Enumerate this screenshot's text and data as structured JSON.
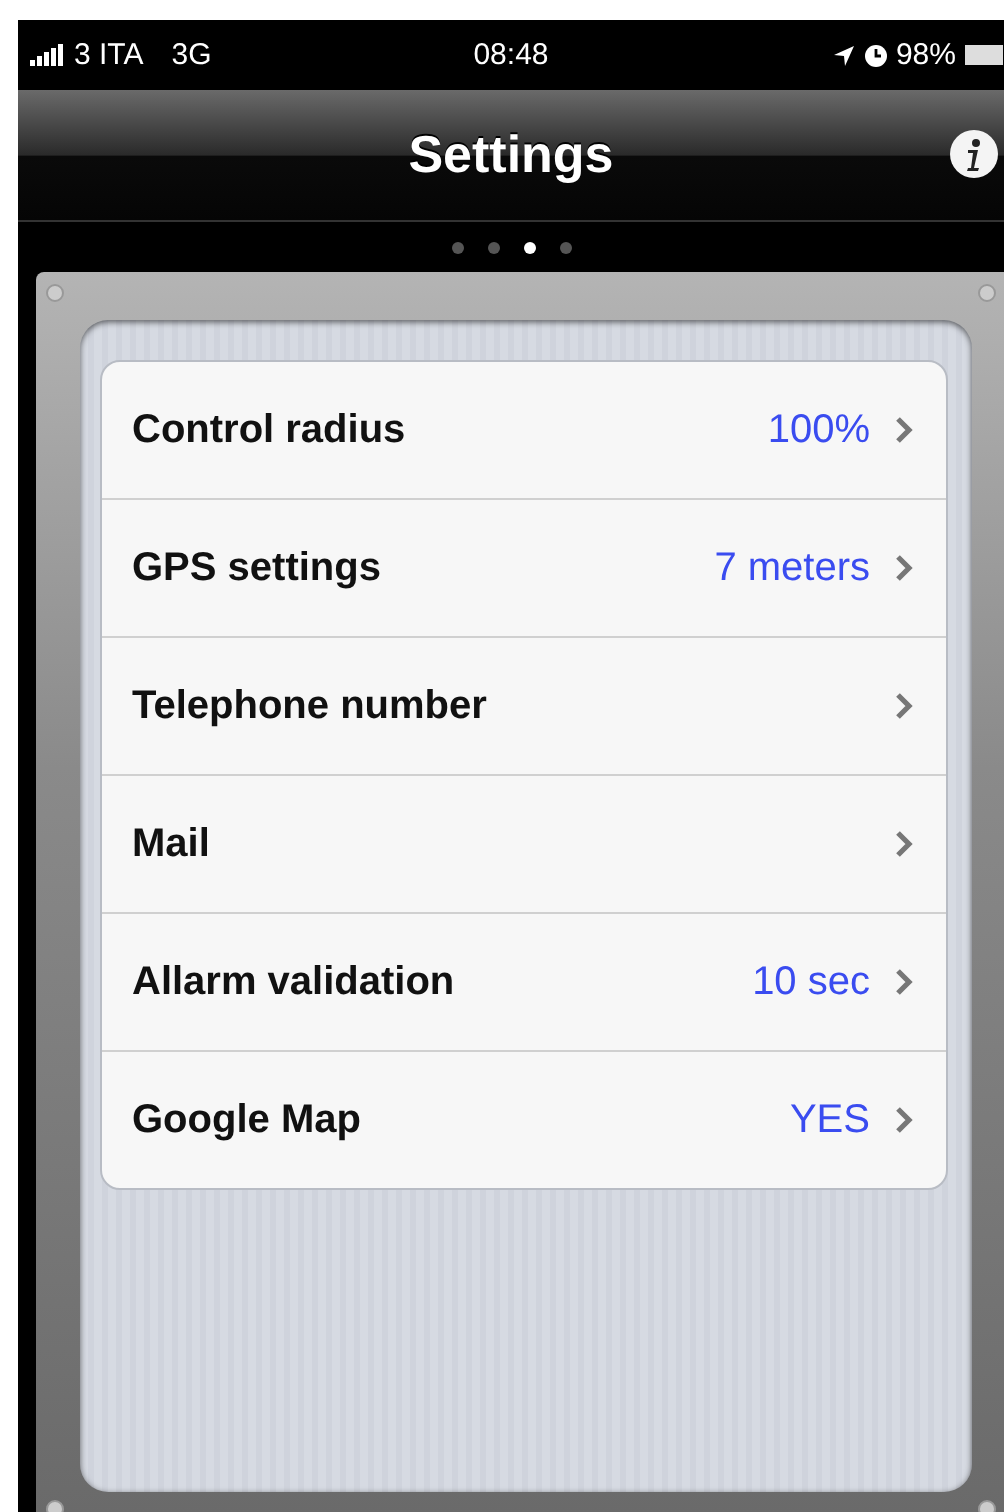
{
  "status_bar": {
    "carrier": "3 ITA",
    "network": "3G",
    "time": "08:48",
    "battery": "98%"
  },
  "nav_bar": {
    "title": "Settings"
  },
  "page_dots": [
    {
      "selected": false
    },
    {
      "selected": false
    },
    {
      "selected": true
    },
    {
      "selected": false
    }
  ],
  "settings": [
    {
      "label": "Control radius",
      "value": "100%"
    },
    {
      "label": "GPS settings",
      "value": "7 meters"
    },
    {
      "label": "Telephone number"
    },
    {
      "label": "Mail"
    },
    {
      "label": "Allarm validation",
      "value": "10 sec"
    },
    {
      "label": "Google Map",
      "value": "YES"
    }
  ]
}
